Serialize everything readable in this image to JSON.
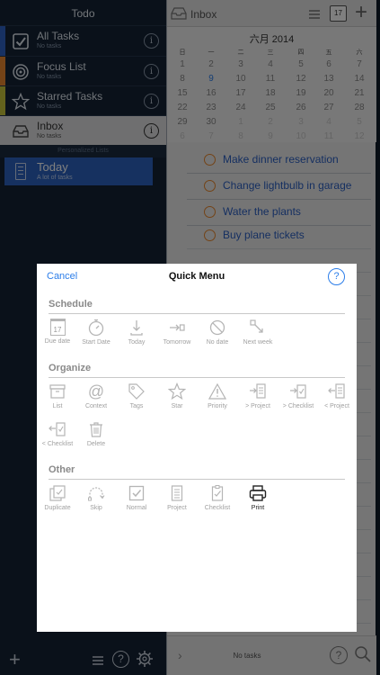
{
  "sidebar": {
    "title": "Todo",
    "items": [
      {
        "label": "All Tasks",
        "sub": "No tasks",
        "color": "#2f62c4"
      },
      {
        "label": "Focus List",
        "sub": "No tasks",
        "color": "#e8872e"
      },
      {
        "label": "Starred Tasks",
        "sub": "No tasks",
        "color": "#c6c43a"
      },
      {
        "label": "Inbox",
        "sub": "No tasks",
        "color": "#dedfe1"
      }
    ],
    "section_label": "Personalized Lists",
    "today": {
      "label": "Today",
      "sub": "A lot of tasks"
    }
  },
  "main": {
    "header": {
      "title": "Inbox",
      "calendar_day": "17"
    },
    "calendar": {
      "month": "六月 2014",
      "weekdays": [
        "日",
        "一",
        "二",
        "三",
        "四",
        "五",
        "六"
      ],
      "weeks": [
        [
          "1",
          "2",
          "3",
          "4",
          "5",
          "6",
          "7"
        ],
        [
          "8",
          "9",
          "10",
          "11",
          "12",
          "13",
          "14"
        ],
        [
          "15",
          "16",
          "17",
          "18",
          "19",
          "20",
          "21"
        ],
        [
          "22",
          "23",
          "24",
          "25",
          "26",
          "27",
          "28"
        ],
        [
          "29",
          "30",
          "1",
          "2",
          "3",
          "4",
          "5"
        ],
        [
          "6",
          "7",
          "8",
          "9",
          "10",
          "11",
          "12"
        ]
      ],
      "today_marker": "9"
    },
    "tasks": [
      "Make dinner reservation",
      "Change lightbulb in garage",
      "Water the plants",
      "Buy plane tickets"
    ],
    "footer": {
      "status": "No tasks"
    }
  },
  "modal": {
    "cancel": "Cancel",
    "title": "Quick Menu",
    "help": "?",
    "sections": {
      "schedule": {
        "title": "Schedule",
        "items": [
          "Due date",
          "Start Date",
          "Today",
          "Tomorrow",
          "No date",
          "Next week"
        ],
        "due_date_number": "17"
      },
      "organize": {
        "title": "Organize",
        "items": [
          "List",
          "Context",
          "Tags",
          "Star",
          "Priority",
          "> Project",
          "> Checklist",
          "< Project",
          "< Checklist",
          "Delete"
        ]
      },
      "other": {
        "title": "Other",
        "items": [
          "Duplicate",
          "Skip",
          "Normal",
          "Project",
          "Checklist",
          "Print"
        ]
      }
    }
  }
}
